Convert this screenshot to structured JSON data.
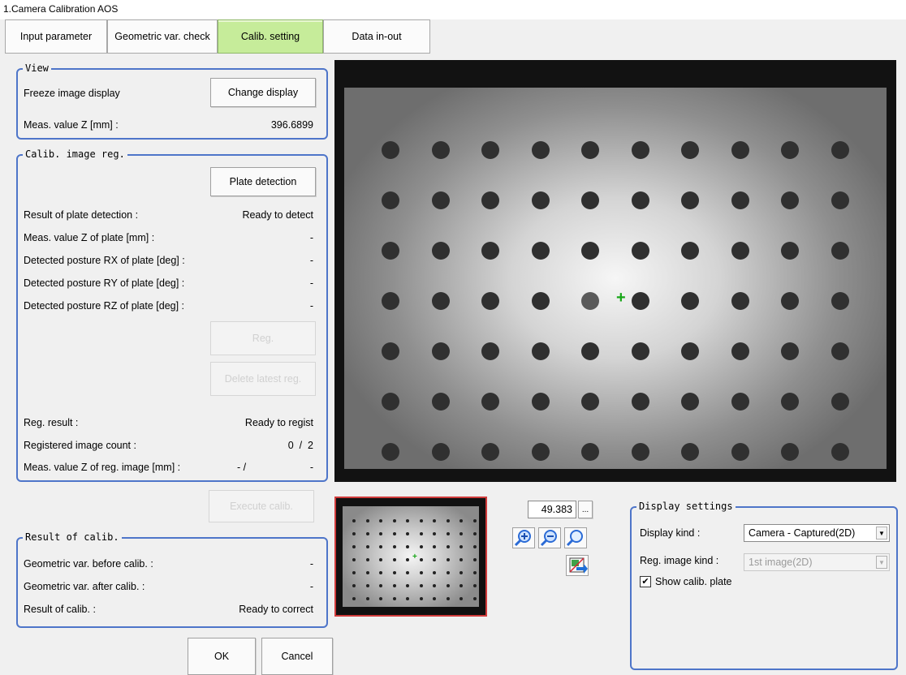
{
  "window": {
    "title": "1.Camera Calibration AOS"
  },
  "tabs": [
    {
      "label": "Input parameter",
      "active": false
    },
    {
      "label": "Geometric var. check",
      "active": false
    },
    {
      "label": "Calib. setting",
      "active": true
    },
    {
      "label": "Data in-out",
      "active": false
    }
  ],
  "view": {
    "legend": "View",
    "freeze_label": "Freeze image display",
    "change_display_button": "Change display",
    "meas_z_label": "Meas. value Z [mm] :",
    "meas_z_value": "396.6899"
  },
  "calib_image_reg": {
    "legend": "Calib. image reg.",
    "plate_detection_button": "Plate detection",
    "rows": [
      {
        "label": "Result of plate detection :",
        "value": "Ready to detect"
      },
      {
        "label": "Meas. value Z of plate [mm] :",
        "value": "-"
      },
      {
        "label": "Detected posture RX of plate [deg] :",
        "value": "-"
      },
      {
        "label": "Detected posture RY of plate [deg] :",
        "value": "-"
      },
      {
        "label": "Detected posture RZ of plate [deg] :",
        "value": "-"
      }
    ],
    "reg_button": "Reg.",
    "delete_latest_button": "Delete latest reg.",
    "reg_result_label": "Reg. result :",
    "reg_result_value": "Ready to regist",
    "registered_count_label": "Registered image count :",
    "registered_count_value": "0  /  2",
    "meas_z_reg_label": "Meas. value Z of reg. image [mm] :",
    "meas_z_reg_value_a": "- /",
    "meas_z_reg_value_b": "-"
  },
  "execute_calib_button": "Execute calib.",
  "result_of_calib": {
    "legend": "Result of calib.",
    "rows": [
      {
        "label": "Geometric var. before calib. :",
        "value": "-"
      },
      {
        "label": "Geometric var. after calib. :",
        "value": "-"
      },
      {
        "label": "Result of calib. :",
        "value": "Ready to correct"
      }
    ]
  },
  "zoom": {
    "value": "49.383",
    "more_button": "..."
  },
  "display_settings": {
    "legend": "Display settings",
    "display_kind_label": "Display kind :",
    "display_kind_value": "Camera - Captured(2D)",
    "reg_image_kind_label": "Reg. image kind :",
    "reg_image_kind_value": "1st image(2D)",
    "show_plate_label": "Show calib. plate",
    "show_plate_checked": true
  },
  "footer": {
    "ok_button": "OK",
    "cancel_button": "Cancel"
  },
  "colors": {
    "accent_border": "#4e75c9",
    "active_tab": "#c6ec9a",
    "crosshair": "#17a617"
  }
}
